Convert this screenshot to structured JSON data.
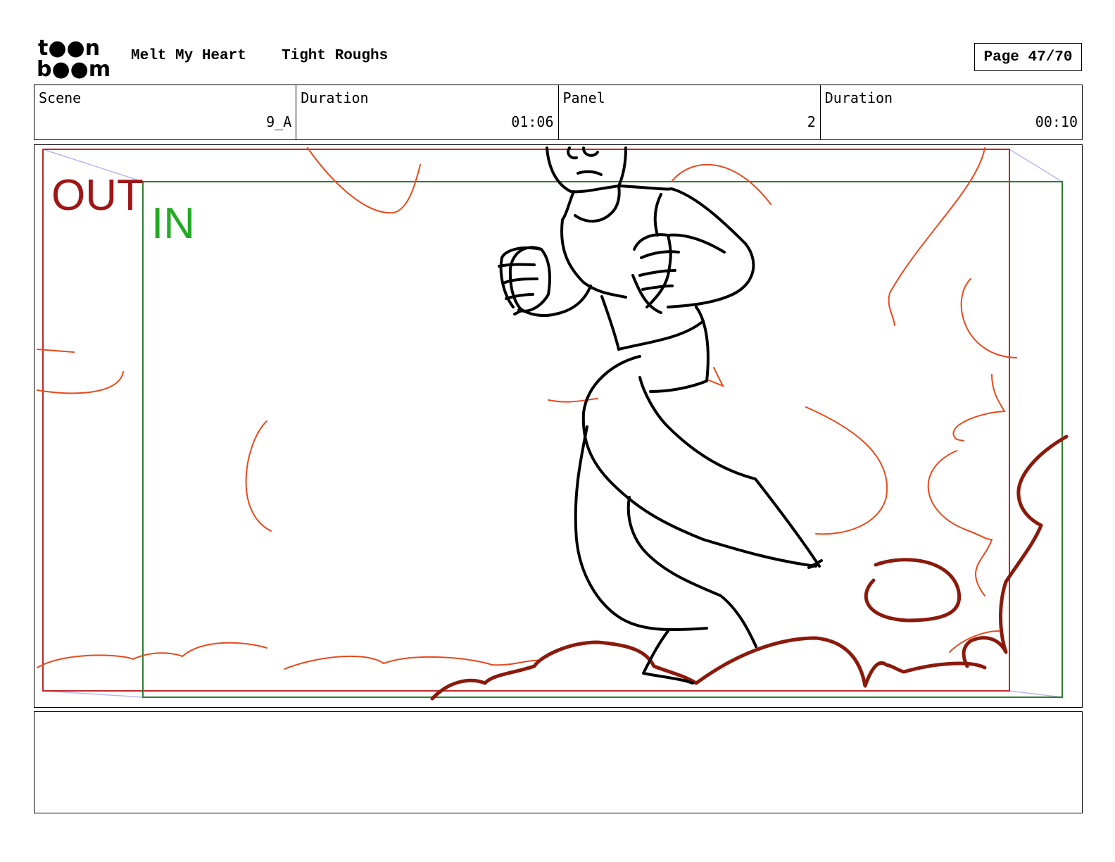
{
  "header": {
    "logo_top": "t●●n",
    "logo_bottom": "b●●m",
    "project_title": "Melt My Heart",
    "stage": "Tight Roughs",
    "page_label": "Page 47/70"
  },
  "info": {
    "scene_label": "Scene",
    "scene_value": "9_A",
    "scene_duration_label": "Duration",
    "scene_duration_value": "01:06",
    "panel_label": "Panel",
    "panel_value": "2",
    "panel_duration_label": "Duration",
    "panel_duration_value": "00:10"
  },
  "panel": {
    "out_label": "OUT",
    "in_label": "IN",
    "colors": {
      "out_frame": "#c0282b",
      "in_frame": "#2e7d32",
      "in_text": "#22aa22",
      "out_text": "#a01515",
      "rough_strokes": "#e8491d",
      "cloud_strokes": "#8b1a0c",
      "character_lines": "#000000",
      "camera_guides": "#b8b8ee"
    }
  },
  "notes": {}
}
